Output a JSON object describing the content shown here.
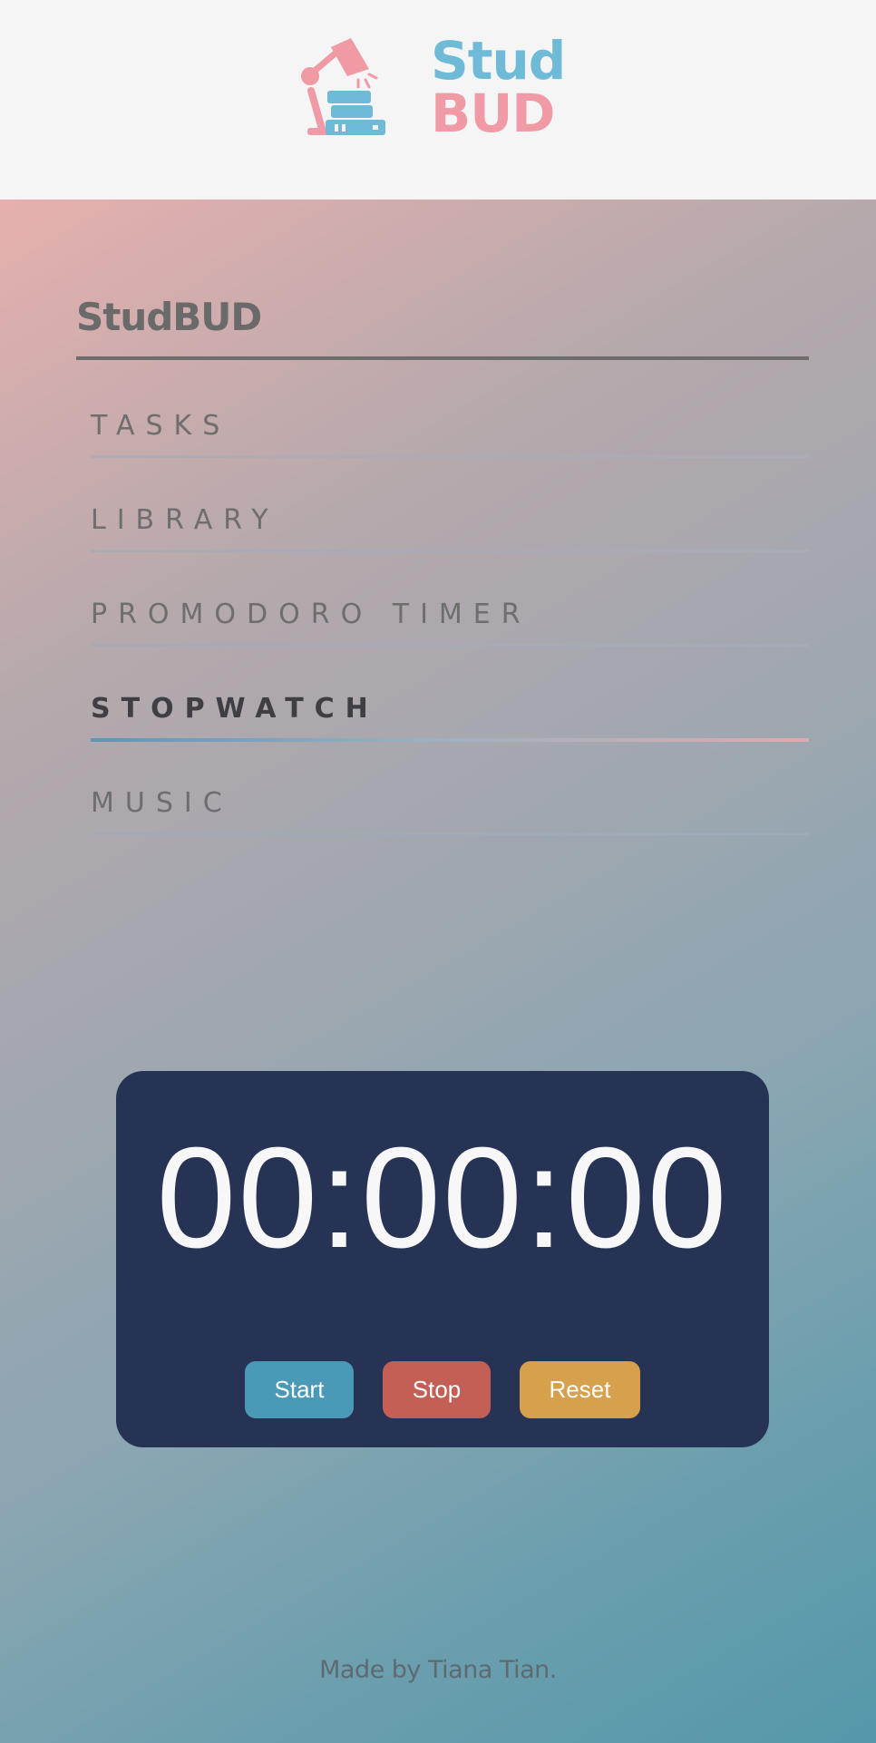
{
  "header": {
    "logo_line1": "Stud",
    "logo_line2": "BUD"
  },
  "nav": {
    "title": "StudBUD",
    "items": [
      {
        "label": "TASKS",
        "active": false
      },
      {
        "label": "LIBRARY",
        "active": false
      },
      {
        "label": "PROMODORO TIMER",
        "active": false
      },
      {
        "label": "STOPWATCH",
        "active": true
      },
      {
        "label": "MUSIC",
        "active": false
      }
    ]
  },
  "stopwatch": {
    "time": "00:00:00",
    "start_label": "Start",
    "stop_label": "Stop",
    "reset_label": "Reset"
  },
  "footer": {
    "text": "Made by Tiana Tian."
  },
  "colors": {
    "logo_blue": "#6fbad7",
    "logo_pink": "#ef9aa4",
    "card_bg": "#263355",
    "start": "#4a9ab7",
    "stop": "#c45f55",
    "reset": "#d7a04c"
  },
  "icons": {
    "logo_graphic": "desk-lamp-books-icon"
  }
}
